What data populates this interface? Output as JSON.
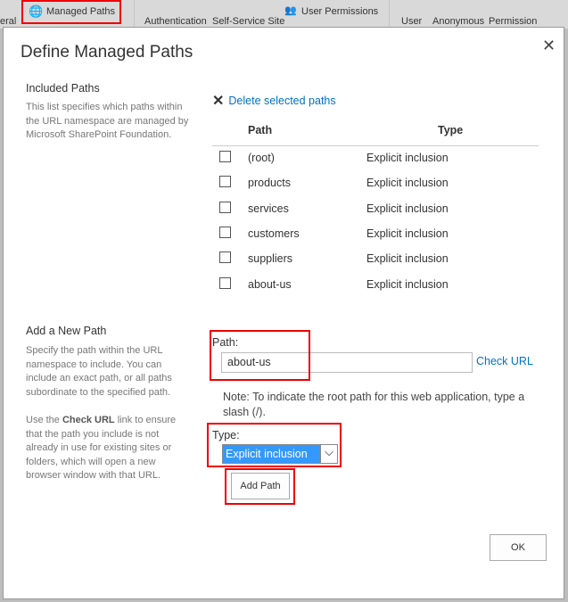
{
  "ribbon": {
    "general": "eral",
    "managed_paths": "Managed Paths",
    "authentication": "Authentication",
    "self_service": "Self-Service Site",
    "user_permissions": "User Permissions",
    "user": "User",
    "anonymous": "Anonymous",
    "permission": "Permission"
  },
  "dialog": {
    "title": "Define Managed Paths",
    "included": {
      "heading": "Included Paths",
      "description": "This list specifies which paths within the URL namespace are managed by Microsoft SharePoint Foundation.",
      "delete_label": "Delete selected paths",
      "columns": [
        "Path",
        "Type"
      ],
      "rows": [
        {
          "path": "(root)",
          "type": "Explicit inclusion"
        },
        {
          "path": "products",
          "type": "Explicit inclusion"
        },
        {
          "path": "services",
          "type": "Explicit inclusion"
        },
        {
          "path": "customers",
          "type": "Explicit inclusion"
        },
        {
          "path": "suppliers",
          "type": "Explicit inclusion"
        },
        {
          "path": "about-us",
          "type": "Explicit inclusion"
        }
      ]
    },
    "add": {
      "heading": "Add a New Path",
      "description1": "Specify the path within the URL namespace to include. You can include an exact path, or all paths subordinate to the specified path.",
      "desc2_pre": "Use the ",
      "desc2_bold": "Check URL",
      "desc2_post": " link to ensure that the path you include is not already in use for existing sites or folders, which will open a new browser window with that URL.",
      "path_label": "Path:",
      "path_value": "about-us",
      "check_url": "Check URL",
      "note": "Note: To indicate the root path for this web application, type a slash (/).",
      "type_label": "Type:",
      "type_value": "Explicit inclusion",
      "add_button": "Add Path"
    },
    "ok": "OK"
  },
  "colors": {
    "highlight": "#e00000",
    "link": "#0072c6",
    "select": "#3399ff"
  }
}
